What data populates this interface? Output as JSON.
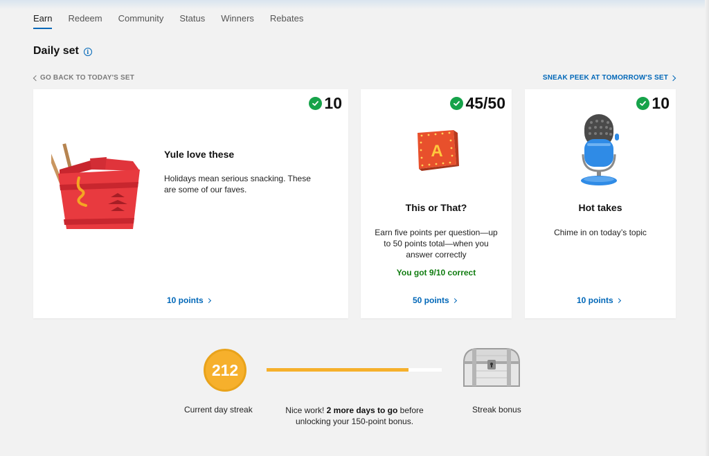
{
  "nav": {
    "tabs": [
      {
        "label": "Earn",
        "active": true
      },
      {
        "label": "Redeem"
      },
      {
        "label": "Community"
      },
      {
        "label": "Status"
      },
      {
        "label": "Winners"
      },
      {
        "label": "Rebates"
      }
    ]
  },
  "section": {
    "title": "Daily set",
    "info_icon": "info-icon",
    "back_label": "GO BACK TO TODAY'S SET",
    "next_label": "SNEAK PEEK AT TOMORROW'S SET"
  },
  "cards": [
    {
      "badge": "10",
      "title": "Yule love these",
      "description": "Holidays mean serious snacking. These are some of our faves.",
      "points_label": "10 points",
      "icon": "takeout-box-icon"
    },
    {
      "badge": "45/50",
      "title": "This or That?",
      "description": "Earn five points per question—up to 50 points total—when you answer correctly",
      "result": "You got 9/10 correct",
      "points_label": "50 points",
      "icon": "letter-a-block-icon"
    },
    {
      "badge": "10",
      "title": "Hot takes",
      "description": "Chime in on today’s topic",
      "points_label": "10 points",
      "icon": "microphone-icon"
    }
  ],
  "streak": {
    "count": "212",
    "label": "Current day streak",
    "progress": 0.81,
    "message_prefix": "Nice work! ",
    "message_bold": "2 more days to go",
    "message_suffix": " before unlocking your 150-point bonus.",
    "bonus_label": "Streak bonus",
    "bonus_icon": "treasure-chest-icon"
  },
  "colors": {
    "accent": "#0067b8",
    "check_green": "#16a34a",
    "success_text": "#107c10",
    "streak_orange": "#f6b02c"
  }
}
